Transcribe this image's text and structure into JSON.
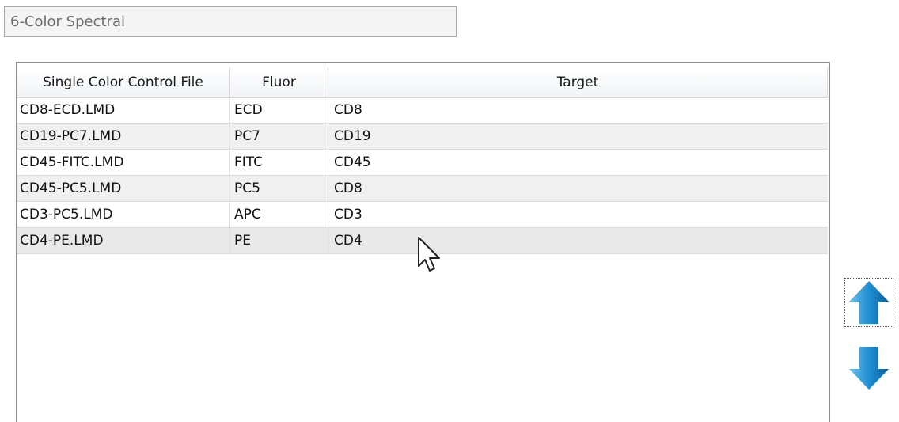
{
  "config_name": {
    "value": "6-Color Spectral"
  },
  "table": {
    "columns": [
      "Single Color Control File",
      "Fluor",
      "Target"
    ],
    "rows": [
      {
        "file": "CD8-ECD.LMD",
        "fluor": "ECD",
        "target": "CD8"
      },
      {
        "file": "CD19-PC7.LMD",
        "fluor": "PC7",
        "target": "CD19"
      },
      {
        "file": "CD45-FITC.LMD",
        "fluor": "FITC",
        "target": "CD45"
      },
      {
        "file": "CD45-PC5.LMD",
        "fluor": "PC5",
        "target": "CD8"
      },
      {
        "file": "CD3-PC5.LMD",
        "fluor": "APC",
        "target": "CD3"
      },
      {
        "file": "CD4-PE.LMD",
        "fluor": "PE",
        "target": "CD4"
      }
    ]
  },
  "controls": {
    "move_up_icon": "arrow-up-icon",
    "move_down_icon": "arrow-down-icon",
    "accent_color": "#1a7fc4"
  }
}
